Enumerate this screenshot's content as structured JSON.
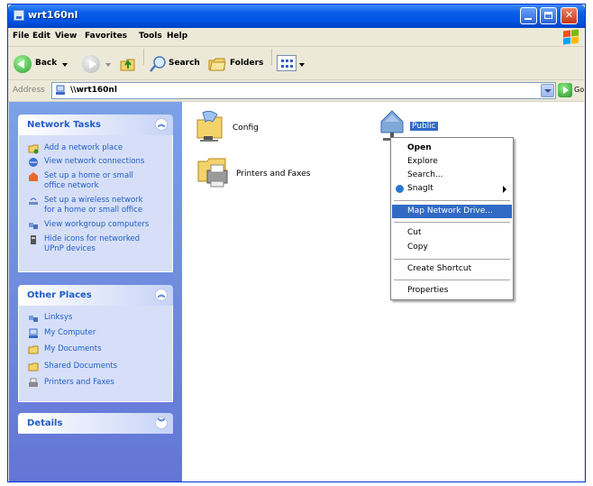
{
  "window": {
    "title": "wrt160nl"
  },
  "menubar": {
    "items": [
      "File",
      "Edit",
      "View",
      "Favorites",
      "Tools",
      "Help"
    ]
  },
  "toolbar": {
    "back_label": "Back",
    "search_label": "Search",
    "folders_label": "Folders"
  },
  "address": {
    "label": "Address",
    "value": "\\\\wrt160nl",
    "go_label": "Go"
  },
  "network_tasks": {
    "title": "Network Tasks",
    "items": [
      {
        "label": "Add a network place",
        "icon": "add-network-place-icon"
      },
      {
        "label": "View network connections",
        "icon": "network-connections-icon"
      },
      {
        "label": "Set up a home or small\noffice network",
        "icon": "home-network-icon"
      },
      {
        "label": "Set up a wireless network\nfor a home or small office",
        "icon": "wireless-network-icon"
      },
      {
        "label": "View workgroup computers",
        "icon": "workgroup-icon"
      },
      {
        "label": "Hide icons for networked\nUPnP devices",
        "icon": "upnp-icon"
      }
    ]
  },
  "other_places": {
    "title": "Other Places",
    "items": [
      {
        "label": "Linksys",
        "icon": "workgroup-icon"
      },
      {
        "label": "My Computer",
        "icon": "computer-icon"
      },
      {
        "label": "My Documents",
        "icon": "folder-icon"
      },
      {
        "label": "Shared Documents",
        "icon": "folder-icon"
      },
      {
        "label": "Printers and Faxes",
        "icon": "printer-icon"
      }
    ]
  },
  "details": {
    "title": "Details"
  },
  "content": {
    "items": [
      {
        "label": "Config",
        "icon": "shared-folder-icon"
      },
      {
        "label": "Printers and Faxes",
        "icon": "printer-icon"
      },
      {
        "label": "Public",
        "icon": "network-share-icon",
        "selected": true
      }
    ]
  },
  "context_menu": {
    "items": [
      "Open",
      "Explore",
      "Search...",
      "SnagIt",
      "Map Network Drive...",
      "Cut",
      "Copy",
      "Create Shortcut",
      "Properties"
    ],
    "highlighted": "Map Network Drive..."
  },
  "colors": {
    "title_bar": "#0054e3",
    "task_pane": "#6f8fe0",
    "highlight": "#316ac5",
    "link": "#215dc6"
  }
}
